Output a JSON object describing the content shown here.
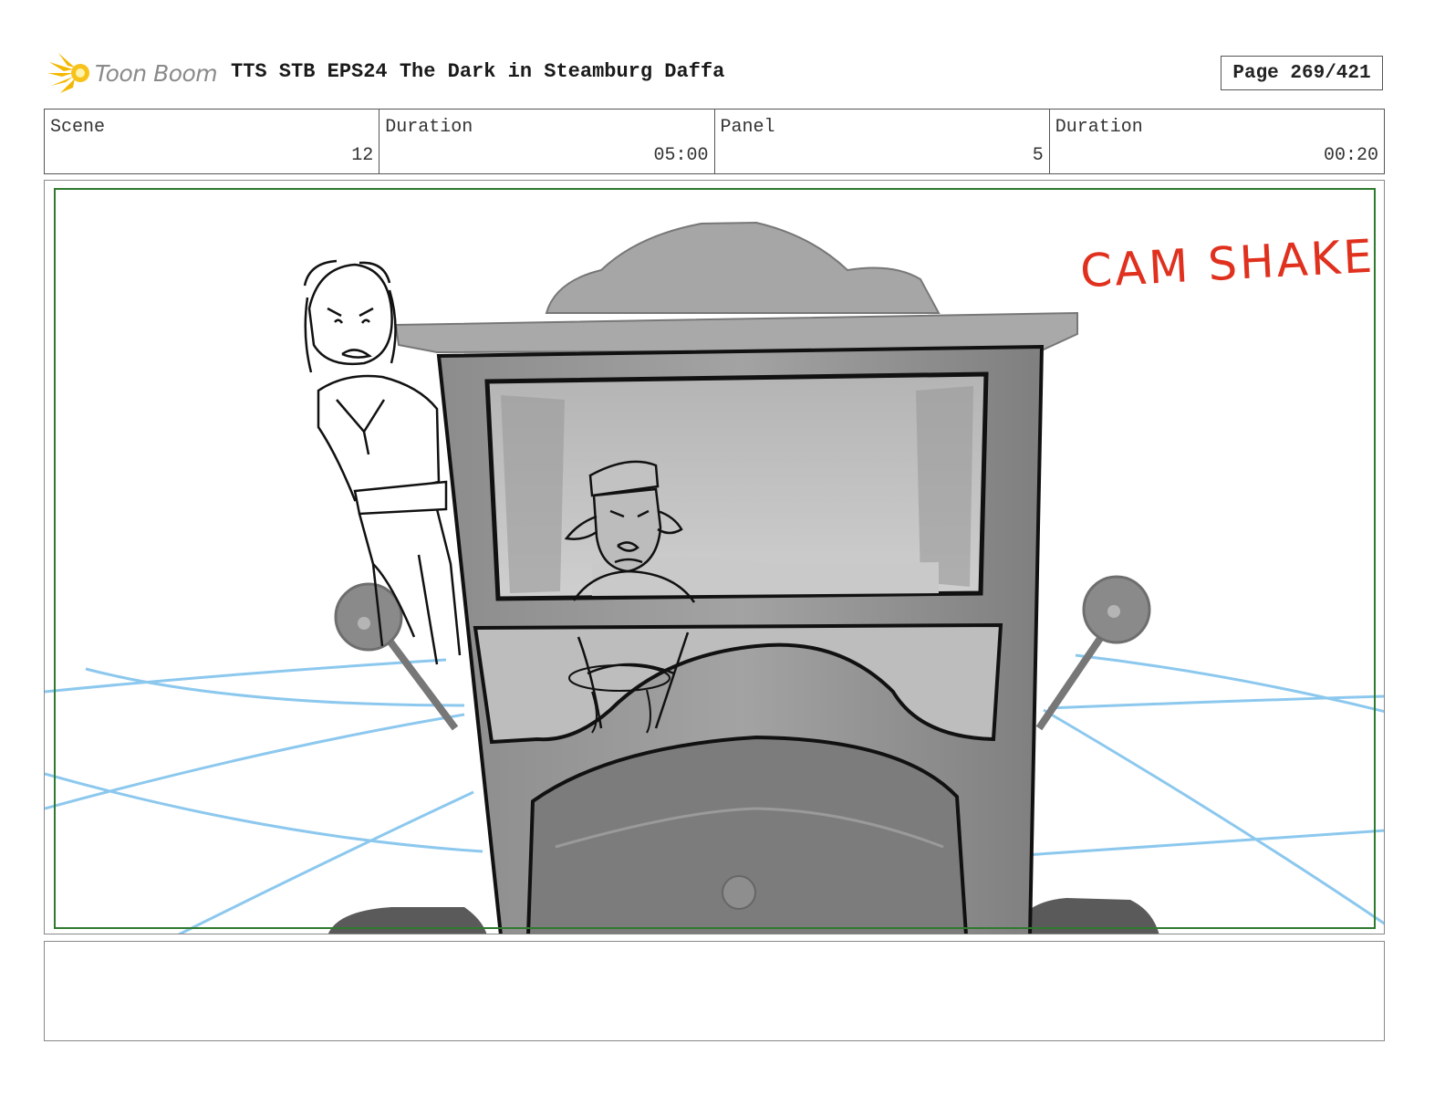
{
  "header": {
    "logo_text": "Toon Boom",
    "title": "TTS STB EPS24 The Dark in Steamburg Daffa",
    "page": "Page 269/421"
  },
  "info": {
    "scene_label": "Scene",
    "scene_value": "12",
    "scene_duration_label": "Duration",
    "scene_duration_value": "05:00",
    "panel_label": "Panel",
    "panel_value": "5",
    "panel_duration_label": "Duration",
    "panel_duration_value": "00:20"
  },
  "panel": {
    "annotation": "CAM SHAKE",
    "annotation_color": "#e0301e",
    "safe_area_color": "#2f7a2f"
  },
  "notes": {
    "text": ""
  }
}
